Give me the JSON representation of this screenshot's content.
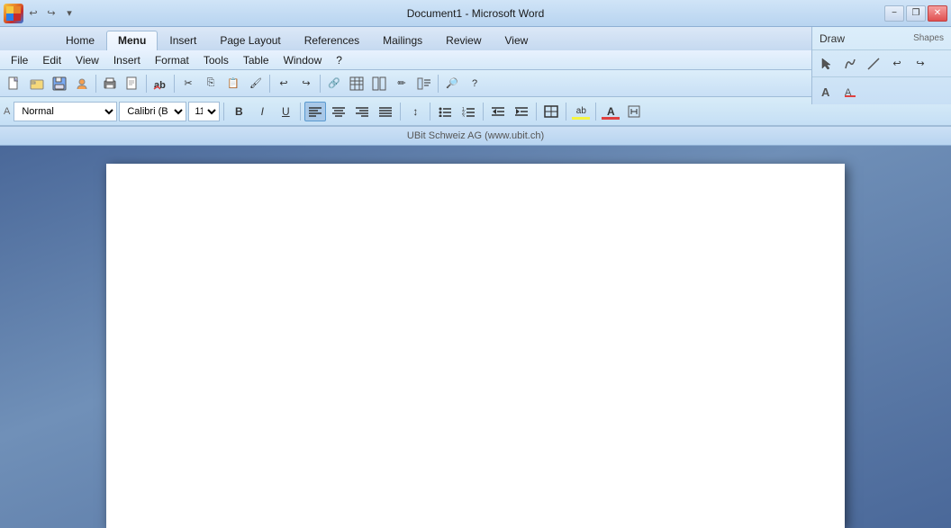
{
  "titlebar": {
    "title": "Document1 - Microsoft Word",
    "minimize_label": "−",
    "restore_label": "❐",
    "close_label": "✕",
    "undo_label": "↩",
    "redo_label": "↪",
    "more_label": "▾"
  },
  "ribbon": {
    "tabs": [
      {
        "id": "home",
        "label": "Home"
      },
      {
        "id": "menu",
        "label": "Menu",
        "active": true
      },
      {
        "id": "insert",
        "label": "Insert"
      },
      {
        "id": "page_layout",
        "label": "Page Layout"
      },
      {
        "id": "references",
        "label": "References"
      },
      {
        "id": "mailings",
        "label": "Mailings"
      },
      {
        "id": "review",
        "label": "Review"
      },
      {
        "id": "view",
        "label": "View"
      }
    ]
  },
  "menubar": {
    "items": [
      {
        "label": "File"
      },
      {
        "label": "Edit"
      },
      {
        "label": "View"
      },
      {
        "label": "Insert"
      },
      {
        "label": "Format"
      },
      {
        "label": "Tools"
      },
      {
        "label": "Table"
      },
      {
        "label": "Window"
      },
      {
        "label": "?"
      }
    ]
  },
  "toolbar": {
    "buttons": [
      {
        "name": "new",
        "icon": "🗋"
      },
      {
        "name": "open",
        "icon": "📂"
      },
      {
        "name": "save",
        "icon": "💾"
      },
      {
        "name": "print",
        "icon": "🖨"
      },
      {
        "name": "preview",
        "icon": "🔍"
      },
      {
        "name": "spelling",
        "icon": "✓"
      },
      {
        "name": "cut",
        "icon": "✂"
      },
      {
        "name": "copy",
        "icon": "⎘"
      },
      {
        "name": "paste",
        "icon": "📋"
      },
      {
        "name": "format-painter",
        "icon": "🖌"
      },
      {
        "name": "undo",
        "icon": "↩"
      },
      {
        "name": "redo",
        "icon": "↪"
      },
      {
        "name": "hyperlink",
        "icon": "🔗"
      },
      {
        "name": "table",
        "icon": "⊞"
      },
      {
        "name": "columns",
        "icon": "≡"
      },
      {
        "name": "drawing",
        "icon": "✏"
      },
      {
        "name": "zoom",
        "icon": "🔎"
      }
    ]
  },
  "format_toolbar": {
    "style": "Normal",
    "font": "Calibri (Body",
    "size": "11",
    "bold": "B",
    "italic": "I",
    "underline": "U",
    "align_left": "≡",
    "align_center": "≡",
    "align_right": "≡",
    "justify": "≡",
    "line_spacing": "↕",
    "bullets": "≡",
    "numbering": "≡",
    "decrease_indent": "◁",
    "increase_indent": "▷",
    "borders": "□",
    "highlight": "ab",
    "font_color": "A"
  },
  "statusbar": {
    "text": "UBit Schweiz AG (www.ubit.ch)"
  },
  "draw_toolbar": {
    "draw_label": "Draw",
    "shapes_label": "Shapes"
  }
}
